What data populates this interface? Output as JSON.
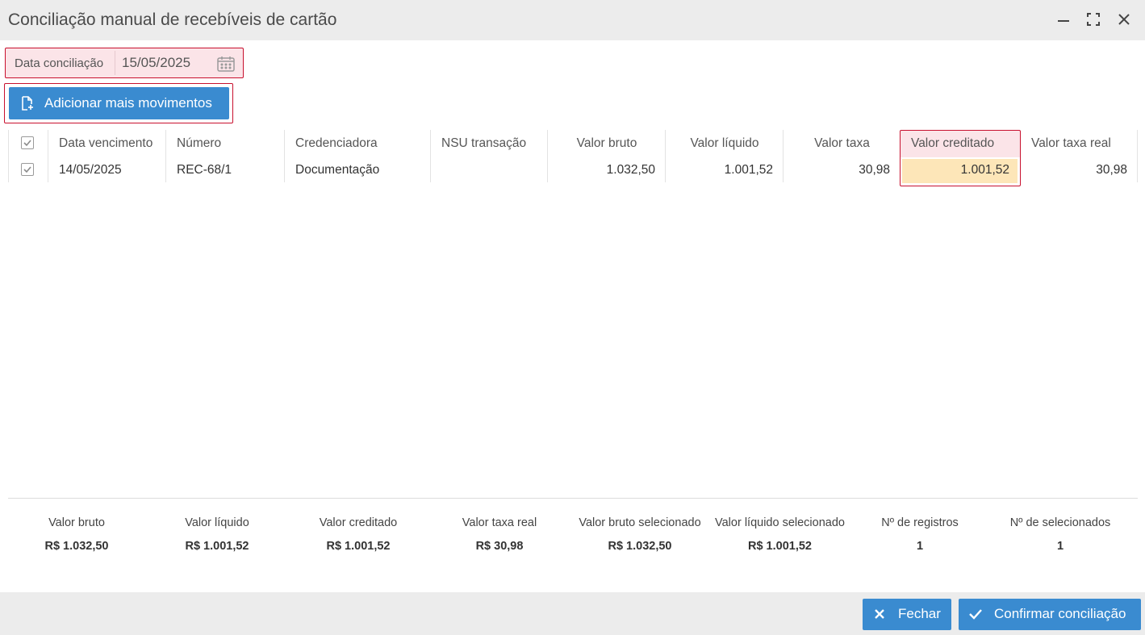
{
  "window": {
    "title": "Conciliação manual de recebíveis de cartão"
  },
  "date": {
    "label": "Data conciliação",
    "value": "15/05/2025"
  },
  "add_button": {
    "label": "Adicionar mais movimentos"
  },
  "table": {
    "headers": [
      "Data vencimento",
      "Número",
      "Credenciadora",
      "NSU transação",
      "Valor bruto",
      "Valor líquido",
      "Valor taxa",
      "Valor creditado",
      "Valor taxa real"
    ],
    "rows": [
      {
        "data_vencimento": "14/05/2025",
        "numero": "REC-68/1",
        "credenciadora": "Documentação",
        "nsu": "",
        "valor_bruto": "1.032,50",
        "valor_liquido": "1.001,52",
        "valor_taxa": "30,98",
        "valor_creditado": "1.001,52",
        "valor_taxa_real": "30,98"
      }
    ]
  },
  "summary": [
    {
      "label": "Valor bruto",
      "value": "R$ 1.032,50"
    },
    {
      "label": "Valor líquido",
      "value": "R$ 1.001,52"
    },
    {
      "label": "Valor creditado",
      "value": "R$ 1.001,52"
    },
    {
      "label": "Valor taxa real",
      "value": "R$ 30,98"
    },
    {
      "label": "Valor bruto selecionado",
      "value": "R$ 1.032,50"
    },
    {
      "label": "Valor líquido selecionado",
      "value": "R$ 1.001,52"
    },
    {
      "label": "Nº de registros",
      "value": "1"
    },
    {
      "label": "Nº de selecionados",
      "value": "1"
    }
  ],
  "footer": {
    "close_label": "Fechar",
    "confirm_label": "Confirmar conciliação"
  },
  "icons": [
    "minimize-icon",
    "maximize-icon",
    "close-icon",
    "calendar-icon",
    "add-document-icon",
    "checkbox-icon",
    "x-icon",
    "check-icon"
  ],
  "colors": {
    "accent": "#3a8bd0",
    "highlight_border": "#c8102e",
    "highlight_bg": "#fbe4e8",
    "edit_cell_bg": "#fde6b8"
  }
}
